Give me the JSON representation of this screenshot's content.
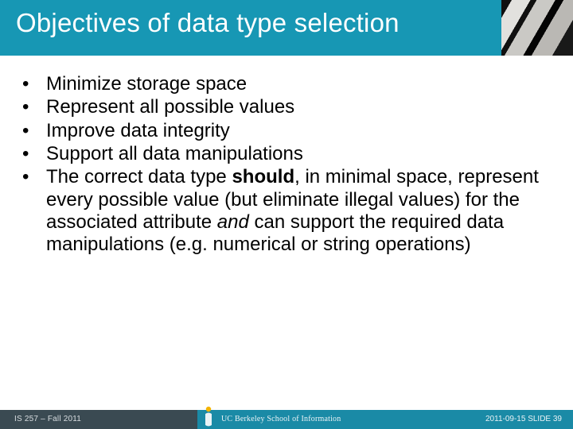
{
  "title": "Objectives of data type selection",
  "bullets": {
    "b1": "Minimize storage space",
    "b2": "Represent all possible values",
    "b3": "Improve data integrity",
    "b4": "Support all data manipulations",
    "b5a": "The correct data type ",
    "b5bold": "should",
    "b5b": ", in minimal space, represent every possible value (but eliminate illegal values) for the associated attribute ",
    "b5ital": "and",
    "b5c": " can support the required data manipulations (e.g. numerical or string operations)"
  },
  "footer": {
    "left": "IS 257 – Fall 2011",
    "logo": "UC Berkeley School of Information",
    "right": "2011-09-15 SLIDE 39"
  }
}
